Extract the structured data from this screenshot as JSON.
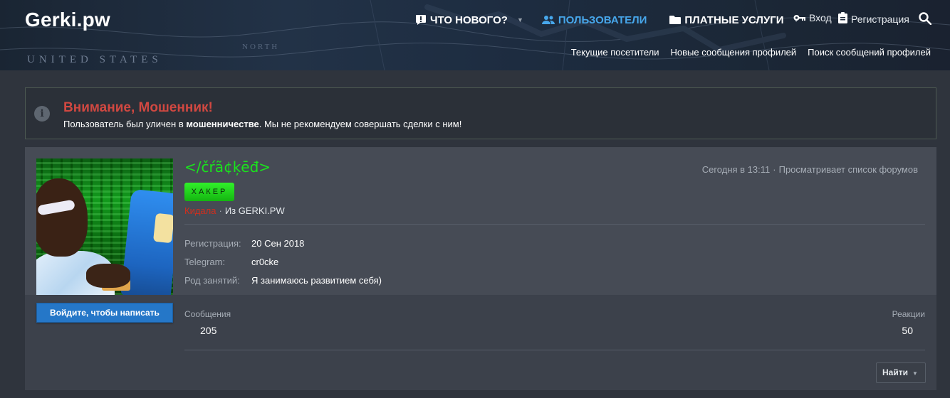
{
  "header": {
    "logo": "Gerki.pw",
    "nav": [
      {
        "label": "Что нового?",
        "icon": "exclaim-bubble-icon"
      },
      {
        "label": "Пользователи",
        "icon": "users-icon",
        "active": true
      },
      {
        "label": "Платные услуги",
        "icon": "folder-icon"
      }
    ],
    "login": "Вход",
    "register": "Регистрация",
    "subnav": [
      "Текущие посетители",
      "Новые сообщения профилей",
      "Поиск сообщений профилей"
    ],
    "map_labels": [
      "UNITED STATES",
      "NORTH"
    ]
  },
  "warning": {
    "title": "Внимание, Мошенник!",
    "text_before": "Пользователь был уличен в ",
    "text_bold": "мошенничестве",
    "text_after": ". Мы не рекомендуем совершать сделки с ним!"
  },
  "profile": {
    "username": "</čŕã¢ķēđ>",
    "last_seen_time": "Сегодня в 13:11",
    "last_seen_sep": "·",
    "last_seen_activity": "Просматривает список форумов",
    "banner": "ХАКЕР",
    "role": "Кидала",
    "status_sep": "·",
    "location": "Из GERKI.PW",
    "facts": [
      {
        "key": "Регистрация:",
        "value": "20 Сен 2018"
      },
      {
        "key": "Telegram:",
        "value": "cr0cke"
      },
      {
        "key": "Род занятий:",
        "value": "Я занимаюсь развитием себя)"
      }
    ],
    "write_button": "Войдите, чтобы написать",
    "stats": {
      "messages_label": "Сообщения",
      "messages_value": "205",
      "reactions_label": "Реакции",
      "reactions_value": "50"
    },
    "find_button": "Найти"
  },
  "colors": {
    "accent": "#47a7eb",
    "warning_title": "#d14841",
    "username": "#19e51c",
    "role": "#d12e1d",
    "button": "#2577c8"
  }
}
